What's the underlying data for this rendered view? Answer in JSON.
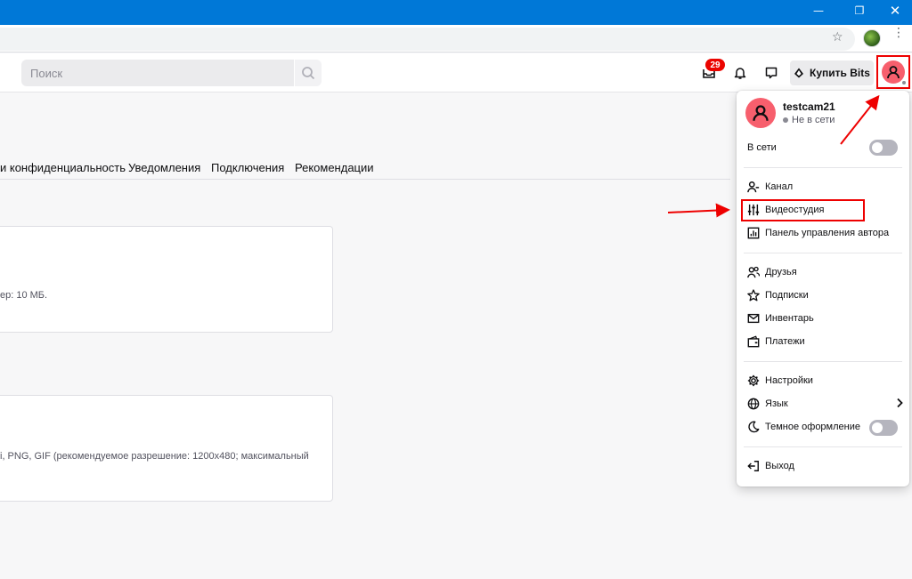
{
  "window": {
    "min_glyph": "—",
    "restore_glyph": "❐",
    "close_glyph": "✕"
  },
  "browser": {
    "star_glyph": "☆",
    "menu_glyph": "⋮"
  },
  "nav": {
    "search_placeholder": "Поиск",
    "inbox_badge": "29",
    "bits_label": "Купить Bits",
    "icons": [
      "search-icon",
      "inbox-icon",
      "bell-icon",
      "whisper-icon",
      "bits-gem-icon",
      "user-avatar-icon"
    ]
  },
  "settings": {
    "tabs": [
      "и конфиденциальность",
      "Уведомления",
      "Подключения",
      "Рекомендации"
    ],
    "card1_text": "ер: 10 МБ.",
    "card2_text": "i, PNG, GIF (рекомендуемое разрешение: 1200x480; максимальный"
  },
  "menu": {
    "username": "testcam21",
    "status": "Не в сети",
    "online_label": "В сети",
    "groups": [
      [
        {
          "label": "Канал",
          "icon": "channel-icon"
        },
        {
          "label": "Видеостудия",
          "icon": "sliders-icon"
        },
        {
          "label": "Панель управления автора",
          "icon": "dashboard-icon"
        }
      ],
      [
        {
          "label": "Друзья",
          "icon": "friends-icon"
        },
        {
          "label": "Подписки",
          "icon": "star-icon"
        },
        {
          "label": "Инвентарь",
          "icon": "inventory-icon"
        },
        {
          "label": "Платежи",
          "icon": "wallet-icon"
        }
      ],
      [
        {
          "label": "Настройки",
          "icon": "gear-icon"
        },
        {
          "label": "Язык",
          "icon": "globe-icon"
        },
        {
          "label": "Темное оформление",
          "icon": "moon-icon"
        }
      ],
      [
        {
          "label": "Выход",
          "icon": "logout-icon"
        }
      ]
    ]
  },
  "colors": {
    "windows_titlebar": "#0078d7",
    "avatar": "#f75f6d",
    "badge": "#eb0400",
    "annotation_red": "#e00000"
  }
}
